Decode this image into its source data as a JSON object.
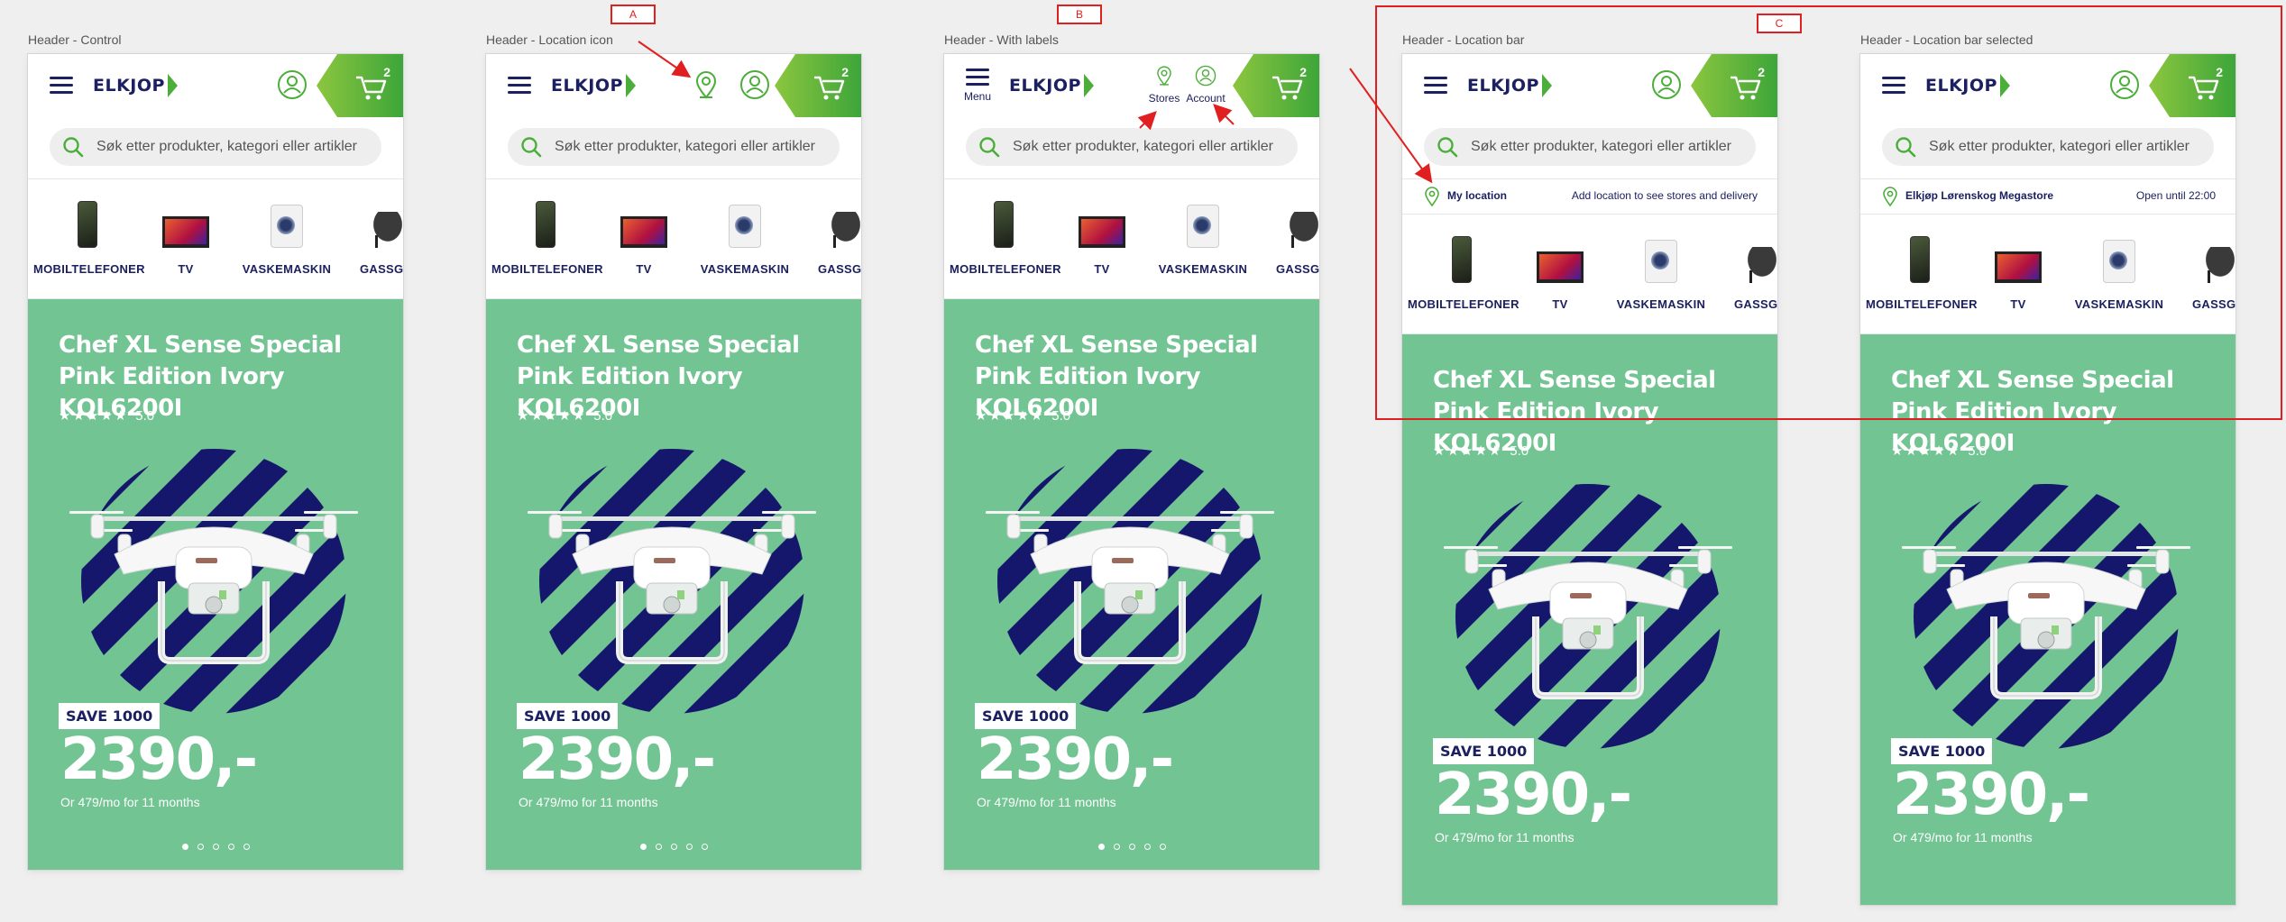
{
  "frames": [
    {
      "label": "Header - Control",
      "tag": "",
      "header_variant": "control",
      "location_bar": null
    },
    {
      "label": "Header - Location icon",
      "tag": "A",
      "header_variant": "location_icon",
      "location_bar": null
    },
    {
      "label": "Header - With labels",
      "tag": "B",
      "header_variant": "labels",
      "location_bar": null
    },
    {
      "label": "Header - Location bar",
      "tag": "C",
      "header_variant": "control",
      "location_bar": {
        "name": "My location",
        "info": "Add location to see stores and delivery"
      }
    },
    {
      "label": "Header - Location bar selected",
      "tag": "",
      "header_variant": "control",
      "location_bar": {
        "name": "Elkjøp Lørenskog Megastore",
        "info": "Open until 22:00"
      }
    }
  ],
  "header": {
    "menu_label": "Menu",
    "logo_text": "ELKJOP",
    "stores_label": "Stores",
    "account_label": "Account",
    "cart_count": "2",
    "icons": [
      "menu-icon",
      "location-pin-icon",
      "account-icon",
      "cart-icon",
      "search-icon"
    ]
  },
  "search": {
    "placeholder": "Søk etter produkter, kategori eller artikler"
  },
  "categories": [
    {
      "label": "MOBILTELEFONER",
      "image": "phone"
    },
    {
      "label": "TV",
      "image": "tv"
    },
    {
      "label": "VASKEMASKIN",
      "image": "washer"
    },
    {
      "label": "GASSGRI",
      "image": "grill"
    }
  ],
  "hero": {
    "title": "Chef XL Sense Special Pink Edition Ivory KQL6200I",
    "stars": "★★★★★",
    "rating_value": "5.0",
    "save_badge": "SAVE 1000",
    "price": "2390,-",
    "finance": "Or 479/mo for 11 months",
    "carousel": {
      "count": 5,
      "active": 0
    }
  },
  "colors": {
    "brand_navy": "#1c2060",
    "brand_green": "#4cae3a",
    "hero_green": "#72c493",
    "annotation_red": "#e02020"
  }
}
